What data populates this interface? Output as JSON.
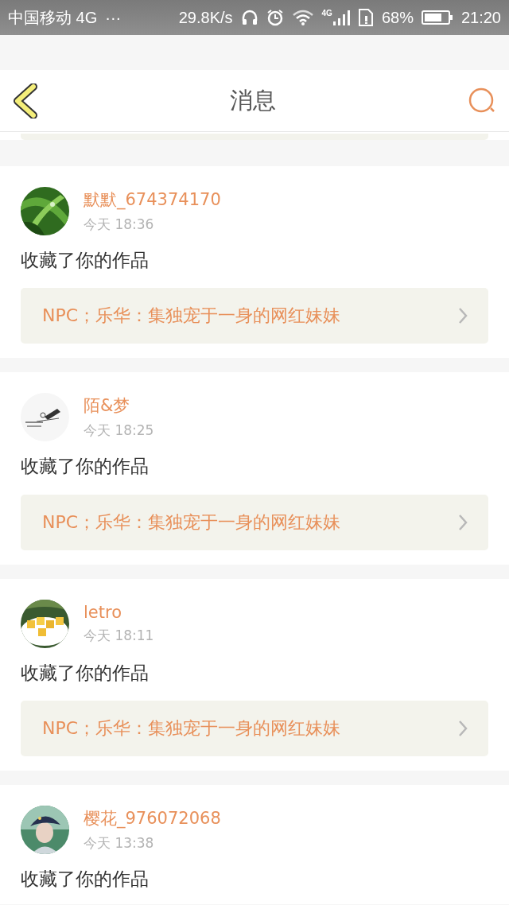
{
  "status_bar": {
    "carrier": "中国移动 4G",
    "more": "···",
    "speed": "29.8K/s",
    "signal_badge": "4G",
    "battery": "68%",
    "time": "21:20"
  },
  "header": {
    "title": "消息"
  },
  "messages": [
    {
      "name": "默默_674374170",
      "time": "今天 18:36",
      "action": "收藏了你的作品",
      "work": "NPC；乐华：集独宠于一身的网红妹妹"
    },
    {
      "name": "陌&梦",
      "time": "今天 18:25",
      "action": "收藏了你的作品",
      "work": "NPC；乐华：集独宠于一身的网红妹妹"
    },
    {
      "name": "letro",
      "time": "今天 18:11",
      "action": "收藏了你的作品",
      "work": "NPC；乐华：集独宠于一身的网红妹妹"
    },
    {
      "name": "樱花_976072068",
      "time": "今天 13:38",
      "action": "收藏了你的作品"
    }
  ]
}
